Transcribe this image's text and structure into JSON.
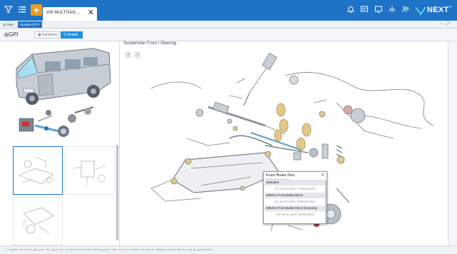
{
  "topbar": {
    "tab_title": "VW MULTIVAN ...",
    "logo_text": "NEXT",
    "logo_mark": "™",
    "bg_color": "#1f73c6",
    "accent_color": "#f39a1e"
  },
  "subbar": {
    "start_label": "Start",
    "active_label": "Kunden-Off"
  },
  "gpi": {
    "label": "GPI",
    "summary_label": "Summary",
    "details_label": "Details"
  },
  "main": {
    "heading": "Suspension Front / Steering"
  },
  "popup": {
    "title": "Front Brake Disc",
    "subtitle": "Please select alternative",
    "items": [
      {
        "header": "Standard",
        "detail": "On stock order 7H0615301F"
      },
      {
        "header": "308mm Front Brake Discs",
        "detail": "On stock order 7E0615301G"
      },
      {
        "header": "308mm Front Brake Discs Economy",
        "detail": "On stock order 2E0615301"
      }
    ]
  },
  "footer": {
    "text": "In general the vehicle data (year, VIN, engine, etc.) are transferred from the ordering system / other source, or selected manually; the displayed parts are therefore only an approximation."
  }
}
